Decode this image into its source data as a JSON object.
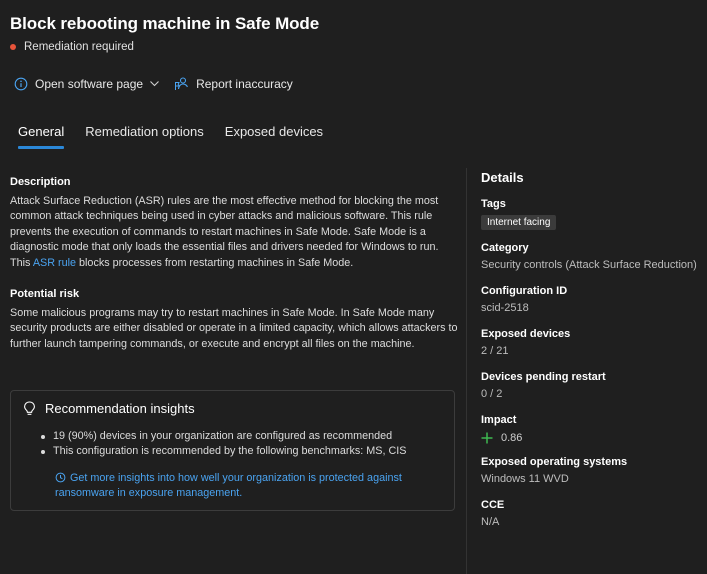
{
  "header": {
    "title": "Block rebooting machine in Safe Mode",
    "status": "Remediation required",
    "status_color": "#e8543a"
  },
  "actions": {
    "open_software": "Open software page",
    "report": "Report inaccuracy"
  },
  "tabs": [
    {
      "label": "General",
      "active": true
    },
    {
      "label": "Remediation options",
      "active": false
    },
    {
      "label": "Exposed devices",
      "active": false
    }
  ],
  "description": {
    "heading": "Description",
    "text_before": "Attack Surface Reduction (ASR) rules are the most effective method for blocking the most common attack techniques being used in cyber attacks and malicious software. This rule prevents the execution of commands to restart machines in Safe Mode. Safe Mode is a diagnostic mode that only loads the essential files and drivers needed for Windows to run. This ",
    "link": "ASR rule",
    "text_after": " blocks processes from restarting machines in Safe Mode."
  },
  "risk": {
    "heading": "Potential risk",
    "text": "Some malicious programs may try to restart machines in Safe Mode. In Safe Mode many security products are either disabled or operate in a limited capacity, which allows attackers to further launch tampering commands, or execute and encrypt all files on the machine."
  },
  "insights": {
    "heading": "Recommendation insights",
    "items": [
      "19 (90%) devices in your organization are configured as recommended",
      "This configuration is recommended by the following benchmarks: MS, CIS"
    ],
    "link": "Get more insights into how well your organization is protected against ransomware in exposure management."
  },
  "details": {
    "heading": "Details",
    "tags_label": "Tags",
    "tag": "Internet facing",
    "category_label": "Category",
    "category": "Security controls (Attack Surface Reduction)",
    "config_id_label": "Configuration ID",
    "config_id": "scid-2518",
    "exposed_label": "Exposed devices",
    "exposed": "2 / 21",
    "pending_label": "Devices pending restart",
    "pending": "0 / 2",
    "impact_label": "Impact",
    "impact": "0.86",
    "os_label": "Exposed operating systems",
    "os": "Windows 11 WVD",
    "cce_label": "CCE",
    "cce": "N/A"
  },
  "colors": {
    "accent": "#2b88d8",
    "link": "#4aa3f0",
    "impact_plus": "#3fb950"
  },
  "icons": {
    "open_software": "info-circle-icon",
    "chevron": "chevron-down-icon",
    "report": "report-person-icon",
    "insights": "lightbulb-icon",
    "insight_link": "refresh-icon",
    "impact": "plus-icon"
  }
}
